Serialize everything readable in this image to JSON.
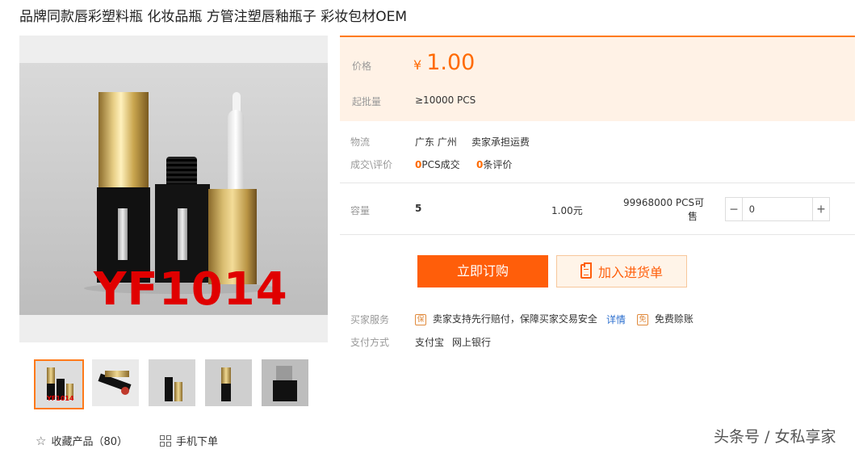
{
  "title": "品牌同款唇彩塑料瓶 化妆品瓶 方管注塑唇釉瓶子 彩妆包材OEM",
  "main_image": {
    "watermark_text": "YF1014"
  },
  "thumbnails": [
    {
      "watermark": "YF1014",
      "selected": true
    },
    {
      "watermark": "",
      "selected": false
    },
    {
      "watermark": "",
      "selected": false
    },
    {
      "watermark": "",
      "selected": false
    },
    {
      "watermark": "",
      "selected": false
    }
  ],
  "favorite": {
    "label": "收藏产品（80）",
    "icon": "star-outline-icon"
  },
  "mobile_order": {
    "label": "手机下单",
    "icon": "qr-code-icon"
  },
  "price": {
    "label": "价格",
    "currency": "¥",
    "value": "1.00"
  },
  "moq": {
    "label": "起批量",
    "value": "≥10000 PCS"
  },
  "logistics": {
    "label": "物流",
    "location": "广东 广州",
    "shipping": "卖家承担运费"
  },
  "transactions": {
    "label": "成交\\评价",
    "deals_count": "0",
    "deals_text": "PCS成交",
    "reviews_count": "0",
    "reviews_text": "条评价"
  },
  "sku": {
    "label": "容量",
    "name": "5",
    "price": "1.00元",
    "stock_line1": "99968000 PCS可",
    "stock_line2": "售",
    "quantity": "0",
    "minus": "−",
    "plus": "+"
  },
  "buttons": {
    "buy_now": "立即订购",
    "add_to_list": "加入进货单"
  },
  "services": {
    "label": "买家服务",
    "badge1": "保",
    "text1": "卖家支持先行赔付，保障买家交易安全",
    "details": "详情",
    "badge2": "免",
    "text2": "免费赊账"
  },
  "payment": {
    "label": "支付方式",
    "method1": "支付宝",
    "method2": "网上银行"
  },
  "footer_watermark": "头条号 / 女私享家",
  "colors": {
    "accent": "#ff5e0a",
    "price": "#ff6a00",
    "price_bg": "#fff2e6",
    "link": "#2c6fcf"
  }
}
